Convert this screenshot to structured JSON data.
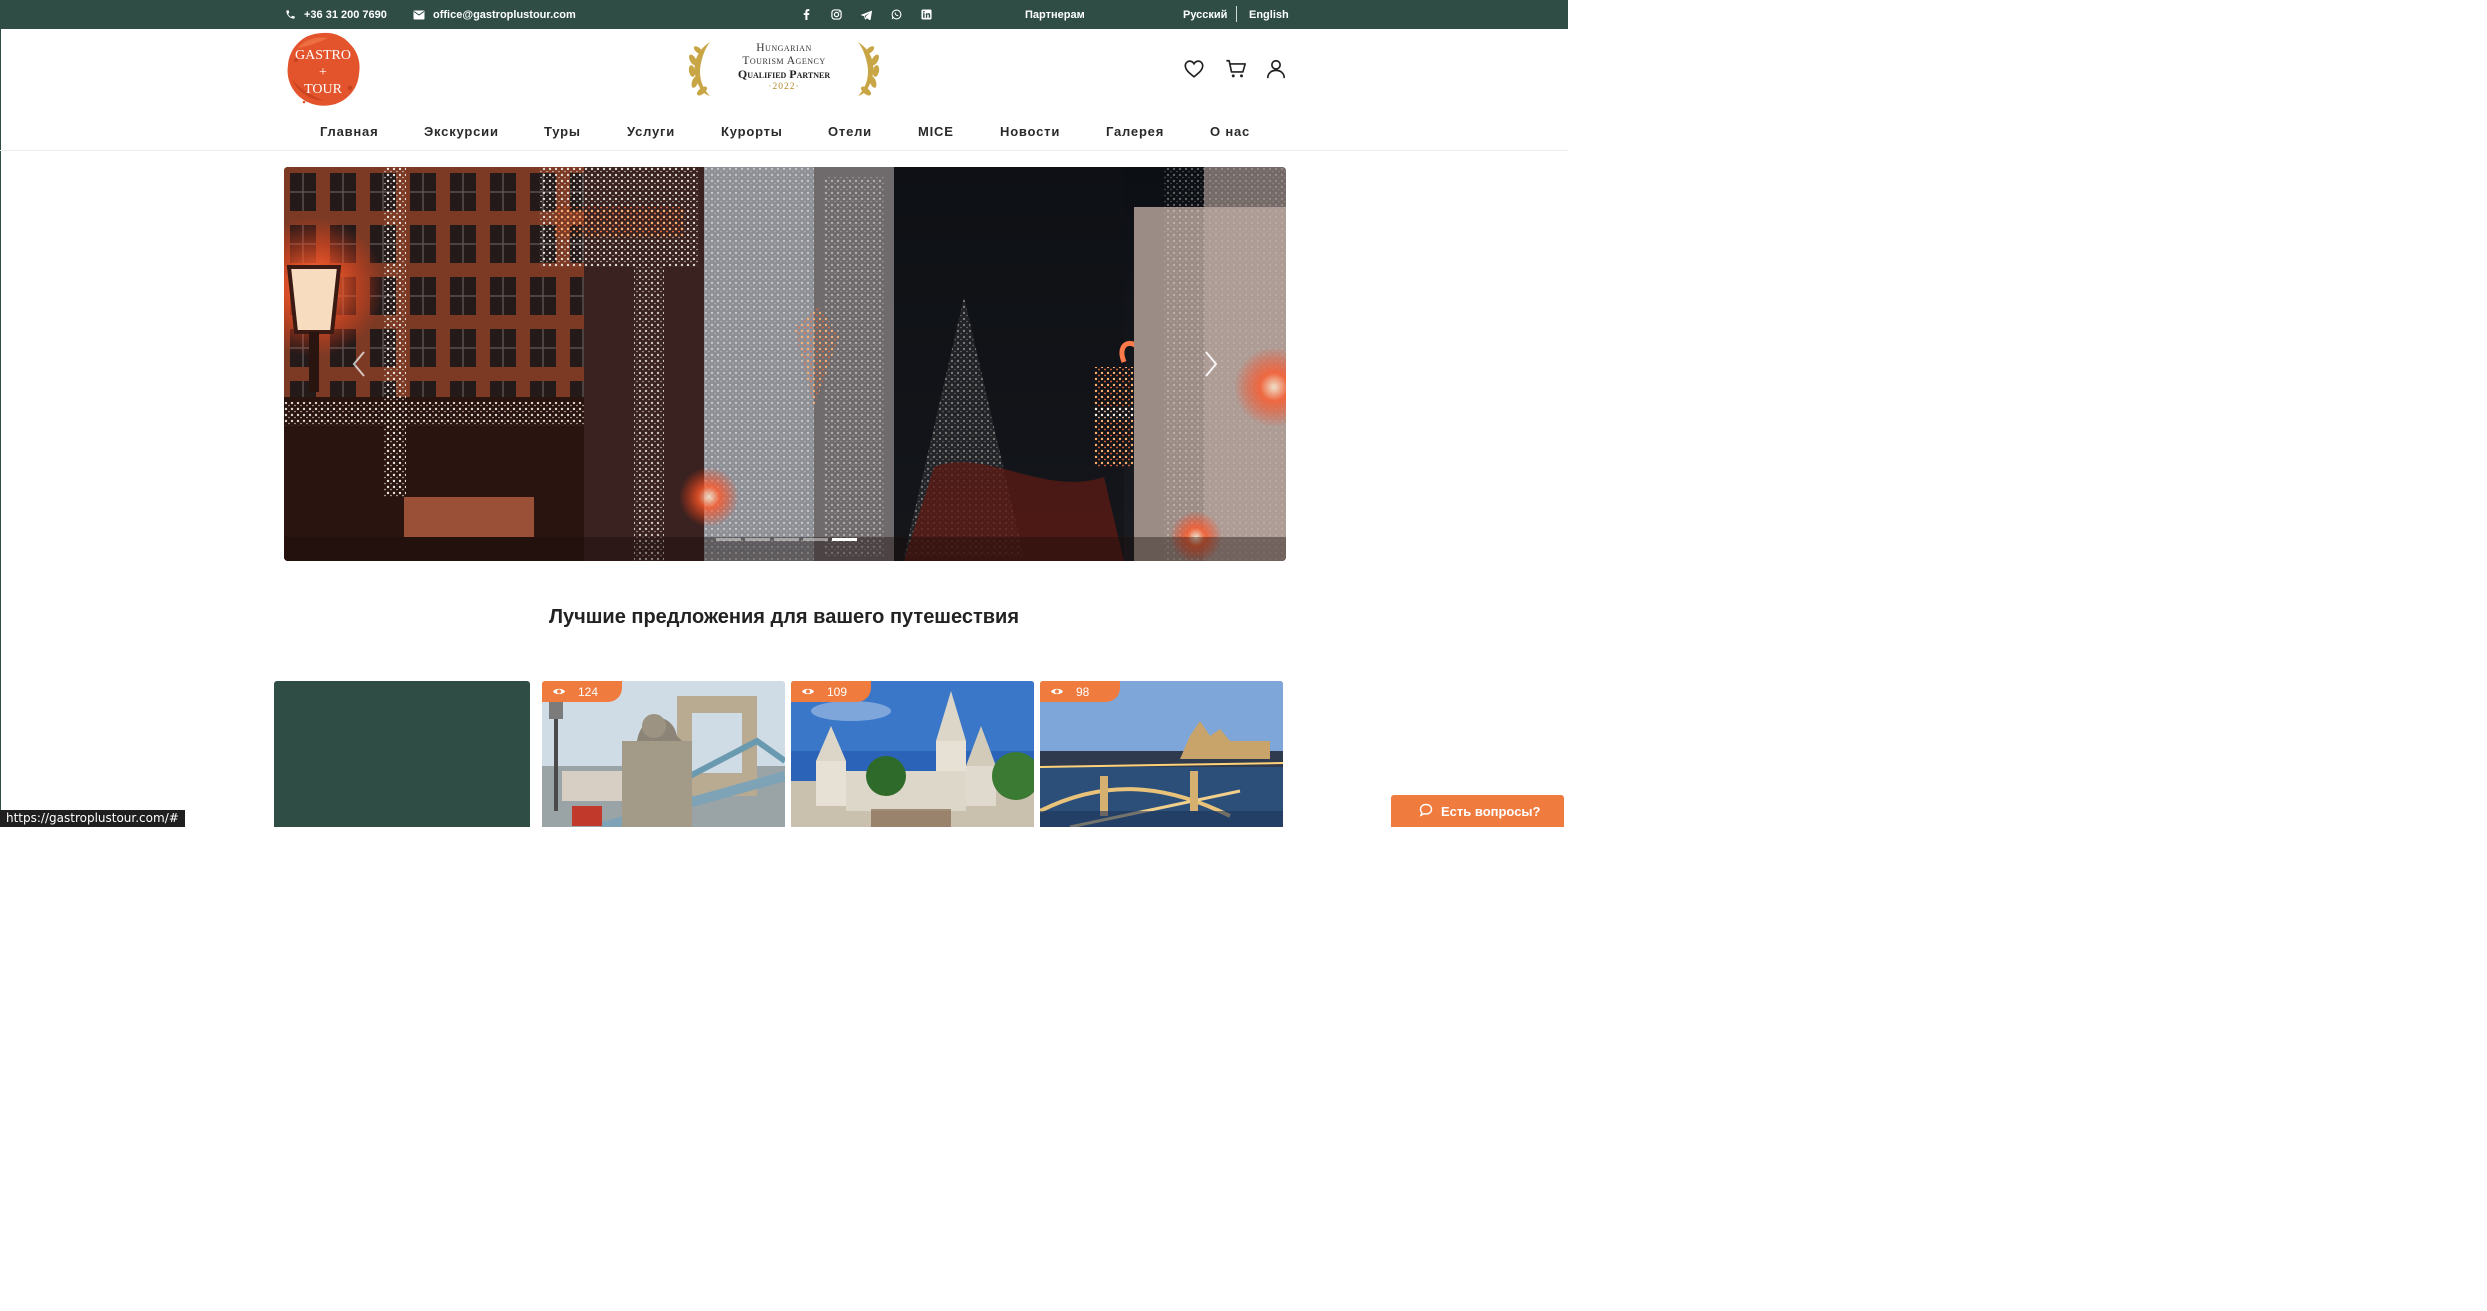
{
  "topbar": {
    "phone": "+36 31 200 7690",
    "email": "office@gastroplustour.com",
    "social_icons": [
      "facebook-icon",
      "instagram-icon",
      "telegram-icon",
      "whatsapp-icon",
      "linkedin-icon"
    ],
    "partners": "Партнерам",
    "languages": [
      "Русский",
      "English"
    ]
  },
  "logo": {
    "lines": [
      "GASTRO",
      "+",
      "TOUR"
    ]
  },
  "badge": {
    "line1": "Hungarian",
    "line2": "Tourism Agency",
    "line3": "Qualified Partner",
    "line4": "·2022·"
  },
  "header_icons": [
    "heart-icon",
    "cart-icon",
    "user-icon"
  ],
  "nav": [
    "Главная",
    "Экскурсии",
    "Туры",
    "Услуги",
    "Курорты",
    "Отели",
    "MICE",
    "Новости",
    "Галерея",
    "О нас"
  ],
  "slider": {
    "slide_count": 5,
    "active_index": 4
  },
  "section_title": "Лучшие предложения для вашего путешествия",
  "cards": [
    {
      "views": "124"
    },
    {
      "views": "109"
    },
    {
      "views": "98"
    }
  ],
  "status_url": "https://gastroplustour.com/#",
  "chat_label": "Есть вопросы?",
  "colors": {
    "brand_green": "#2f4d45",
    "accent_orange": "#f07b3f"
  }
}
